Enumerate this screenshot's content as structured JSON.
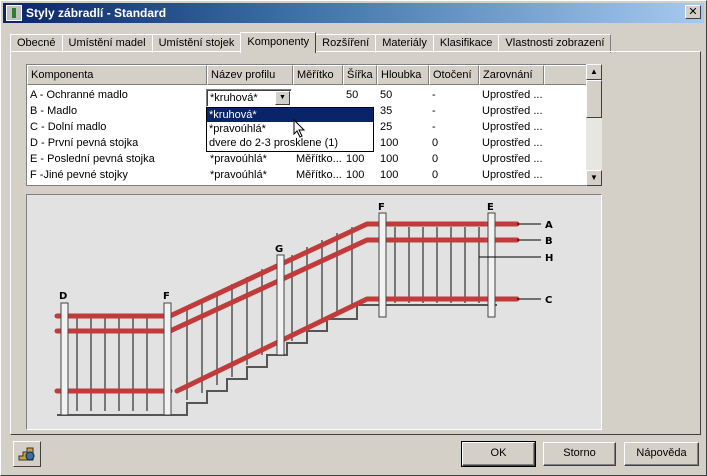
{
  "window": {
    "title": "Styly zábradlí - Standard",
    "close_glyph": "✕"
  },
  "tabs": [
    {
      "label": "Obecné"
    },
    {
      "label": "Umístění madel"
    },
    {
      "label": "Umístění stojek"
    },
    {
      "label": "Komponenty"
    },
    {
      "label": "Rozšíření"
    },
    {
      "label": "Materiály"
    },
    {
      "label": "Klasifikace"
    },
    {
      "label": "Vlastnosti zobrazení"
    }
  ],
  "table": {
    "columns": [
      "Komponenta",
      "Název profilu",
      "Měřítko",
      "Šířka",
      "Hloubka",
      "Otočení",
      "Zarovnání"
    ],
    "rows": [
      {
        "komponenta": "A - Ochranné madlo",
        "profil": "*kruhová*",
        "meritko": "",
        "sirka": "50",
        "hloubka": "50",
        "otoceni": "-",
        "zarovnani": "Uprostřed ..."
      },
      {
        "komponenta": "B - Madlo",
        "profil": "",
        "meritko": "",
        "sirka": "",
        "hloubka": "35",
        "otoceni": "-",
        "zarovnani": "Uprostřed ..."
      },
      {
        "komponenta": "C - Dolní madlo",
        "profil": "",
        "meritko": "",
        "sirka": "",
        "hloubka": "25",
        "otoceni": "-",
        "zarovnani": "Uprostřed ..."
      },
      {
        "komponenta": "D - První pevná stojka",
        "profil": "",
        "meritko": "",
        "sirka": "",
        "hloubka": "100",
        "otoceni": "0",
        "zarovnani": "Uprostřed ..."
      },
      {
        "komponenta": "E - Poslední pevná stojka",
        "profil": "*pravoúhlá*",
        "meritko": "Měřítko...",
        "sirka": "100",
        "hloubka": "100",
        "otoceni": "0",
        "zarovnani": "Uprostřed ..."
      },
      {
        "komponenta": "F -Jiné pevné stojky",
        "profil": "*pravoúhlá*",
        "meritko": "Měřítko...",
        "sirka": "100",
        "hloubka": "100",
        "otoceni": "0",
        "zarovnani": "Uprostřed ..."
      }
    ]
  },
  "combo": {
    "value": "*kruhová*"
  },
  "dropdown": {
    "options": [
      "*kruhová*",
      "*pravoúhlá*",
      "dvere do 2-3 prosklene (1)"
    ],
    "selected_index": 0
  },
  "drawing": {
    "labels": [
      "A",
      "B",
      "H",
      "C",
      "D",
      "F",
      "G",
      "F",
      "E"
    ],
    "rail_color": "#c23b3b"
  },
  "buttons": {
    "ok": "OK",
    "cancel": "Storno",
    "help": "Nápověda"
  },
  "colors": {
    "selection": "#0a246a",
    "title_bar": "#0a246a"
  }
}
